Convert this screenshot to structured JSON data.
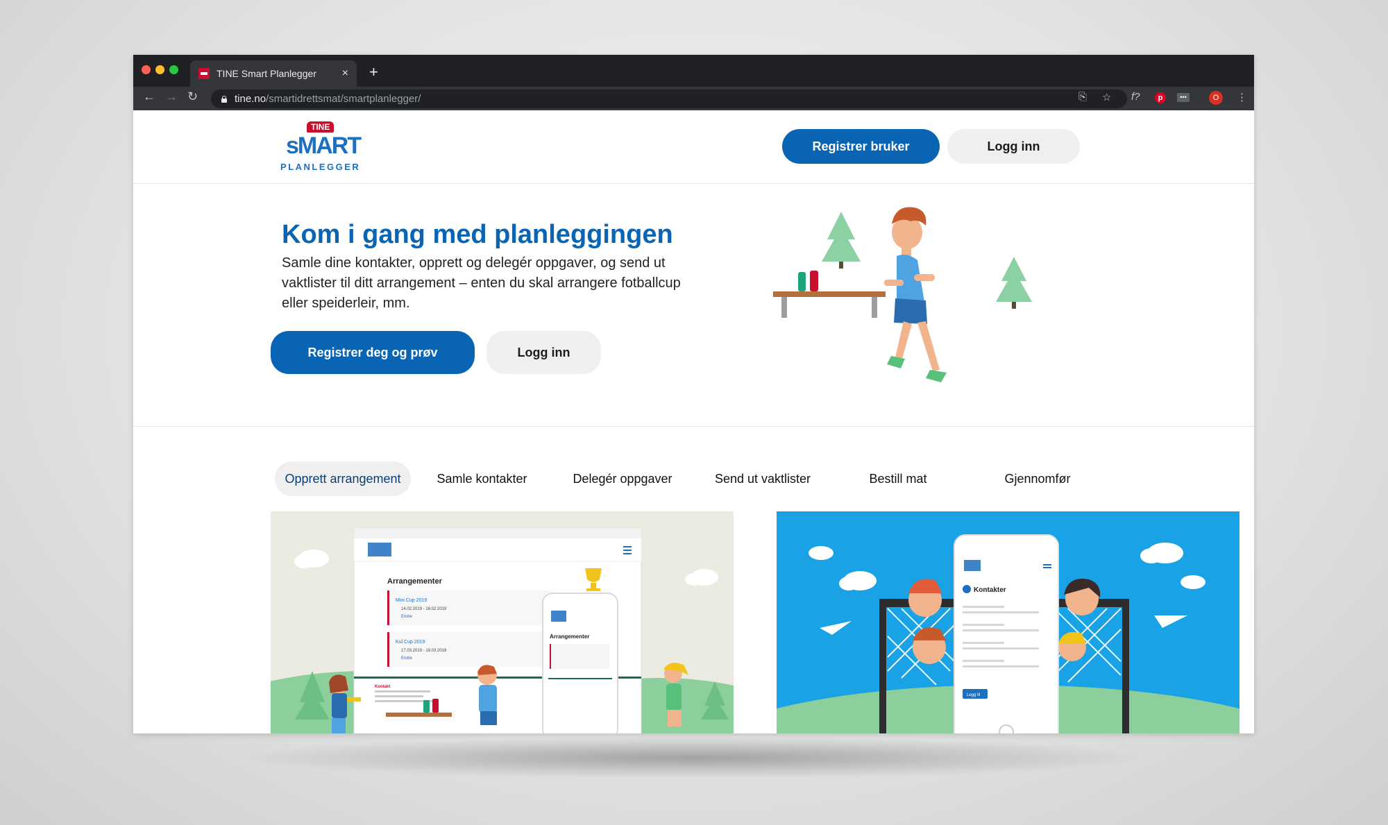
{
  "browser": {
    "tab_title": "TINE Smart Planlegger",
    "tab_close": "×",
    "new_tab": "+",
    "url_host": "tine.no",
    "url_path": "/smartidrettsmat/smartplanlegger/",
    "avatar_letter": "O"
  },
  "header": {
    "logo_brand": "TINE",
    "logo_title": "sMART",
    "logo_subtitle": "PLANLEGGER",
    "register_label": "Registrer bruker",
    "login_label": "Logg inn"
  },
  "hero": {
    "title": "Kom i gang med planleggingen",
    "text": "Samle dine kontakter, opprett og delegér oppgaver, og send ut vaktlister til ditt arrangement – enten du skal arrangere fotballcup eller speiderleir, mm.",
    "register_label": "Registrer deg og prøv",
    "login_label": "Logg inn"
  },
  "feature_tabs": [
    {
      "label": "Opprett arrangement",
      "active": true
    },
    {
      "label": "Samle kontakter",
      "active": false
    },
    {
      "label": "Delegér oppgaver",
      "active": false
    },
    {
      "label": "Send ut vaktlister",
      "active": false
    },
    {
      "label": "Bestill mat",
      "active": false
    },
    {
      "label": "Gjennomfør",
      "active": false
    }
  ],
  "card_left": {
    "screen_heading": "Arrangementer",
    "events": [
      {
        "name": "Mini Cup 2019",
        "dates": "14.02.2019 - 16.02.2019",
        "edit": "Endre"
      },
      {
        "name": "Kul Cup 2019",
        "dates": "17.03.2019 - 18.03.2019",
        "edit": "Endre"
      }
    ],
    "contact_label": "Kontakt"
  },
  "card_right": {
    "screen_heading": "Kontakter",
    "button_label": "Legg til"
  },
  "colors": {
    "primary": "#0a64b4",
    "secondary_bg": "#efefef",
    "brand_red": "#c8102e",
    "card_left_bg": "#ecebe1",
    "card_right_bg": "#19a3e6"
  }
}
